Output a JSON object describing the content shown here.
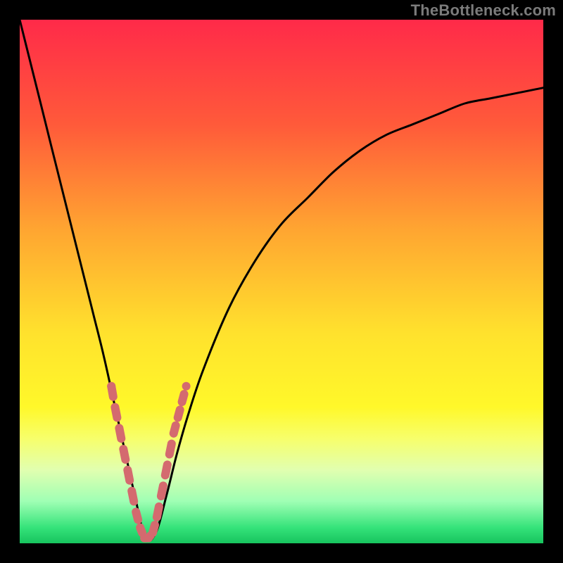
{
  "watermark": "TheBottleneck.com",
  "colors": {
    "gradient_stops": [
      {
        "pct": 0,
        "hex": "#ff2a49"
      },
      {
        "pct": 20,
        "hex": "#ff5a3a"
      },
      {
        "pct": 40,
        "hex": "#ffa531"
      },
      {
        "pct": 60,
        "hex": "#ffe22d"
      },
      {
        "pct": 74,
        "hex": "#fff82a"
      },
      {
        "pct": 80,
        "hex": "#f7ff6b"
      },
      {
        "pct": 86,
        "hex": "#e1ffb0"
      },
      {
        "pct": 92,
        "hex": "#9fffb4"
      },
      {
        "pct": 97,
        "hex": "#35e37a"
      },
      {
        "pct": 100,
        "hex": "#17c45e"
      }
    ],
    "curve": "#000000",
    "markers": "#d46a6f",
    "frame": "#000000"
  },
  "chart_data": {
    "type": "line",
    "title": "",
    "xlabel": "",
    "ylabel": "",
    "xlim": [
      0,
      100
    ],
    "ylim": [
      0,
      100
    ],
    "note": "V-shaped bottleneck curve; y is mismatch percentage (0 at optimum). Minimum around x≈24. Pink markers highlight the low-bottleneck region near the trough.",
    "series": [
      {
        "name": "bottleneck-curve",
        "x": [
          0,
          2,
          4,
          6,
          8,
          10,
          12,
          14,
          16,
          18,
          20,
          22,
          24,
          26,
          28,
          30,
          32,
          35,
          40,
          45,
          50,
          55,
          60,
          65,
          70,
          75,
          80,
          85,
          90,
          95,
          100
        ],
        "y": [
          100,
          92,
          84,
          76,
          68,
          60,
          52,
          44,
          36,
          27,
          18,
          9,
          1,
          2,
          9,
          17,
          24,
          33,
          45,
          54,
          61,
          66,
          71,
          75,
          78,
          80,
          82,
          84,
          85,
          86,
          87
        ]
      }
    ],
    "markers": {
      "name": "near-optimal-band",
      "x": [
        17.5,
        18.2,
        19.0,
        19.8,
        20.6,
        21.4,
        22.2,
        23.0,
        23.8,
        24.6,
        25.4,
        26.2,
        27.0,
        27.8,
        28.6,
        29.4,
        30.2,
        31.0,
        31.8
      ],
      "y": [
        30,
        26,
        22,
        18,
        14,
        10,
        6,
        3,
        1,
        1,
        2,
        5,
        9,
        13,
        17,
        21,
        24,
        27,
        30
      ]
    }
  }
}
